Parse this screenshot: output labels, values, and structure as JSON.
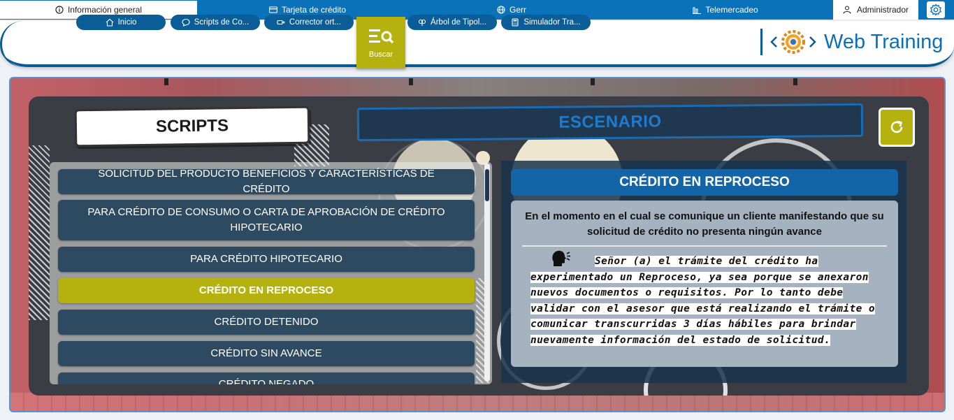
{
  "topbar": {
    "tabs": [
      {
        "label": "Información general",
        "icon": "info-icon",
        "active": true
      },
      {
        "label": "Tarjeta de crédito",
        "icon": "credit-card-icon",
        "active": false
      },
      {
        "label": "Gerr",
        "icon": "globe-icon",
        "active": false
      },
      {
        "label": "Telemercadeo",
        "icon": "chart-icon",
        "active": false
      }
    ],
    "user": "Administrador"
  },
  "nav": {
    "items": [
      {
        "label": "Inicio",
        "icon": "home-icon"
      },
      {
        "label": "Scripts de Co...",
        "icon": "chat-icon"
      },
      {
        "label": "Corrector ort...",
        "icon": "spellcheck-icon"
      },
      {
        "label": "Árbol de Tipol...",
        "icon": "tree-icon"
      },
      {
        "label": "Simulador Tra...",
        "icon": "calculator-icon"
      }
    ],
    "search_label": "Buscar",
    "brand": "Web Training"
  },
  "scripts": {
    "title": "SCRIPTS",
    "items": [
      "SOLICITUD DEL PRODUCTO BENEFICIOS Y CARACTERÍSTICAS DE CRÉDITO",
      "PARA CRÉDITO DE CONSUMO O CARTA DE APROBACIÓN DE CRÉDITO HIPOTECARIO",
      "PARA CRÉDITO HIPOTECARIO",
      "CRÉDITO EN REPROCESO",
      "CRÉDITO DETENIDO",
      "CRÉDITO SIN AVANCE",
      "CRÉDITO NEGADO"
    ],
    "active_index": 3
  },
  "escenario": {
    "title": "ESCENARIO",
    "header": "CRÉDITO EN REPROCESO",
    "description": "En el momento en el cual se comunique un cliente manifestando que su solicitud de crédito no presenta ningún avance",
    "script": "Señor (a) el trámite del crédito ha experimentado un Reproceso, ya sea porque se anexaron nuevos documentos o requisitos. Por lo tanto debe validar con el asesor que está realizando el trámite o comunicar transcurridas 3 días hábiles para brindar nuevamente información del estado de solicitud."
  },
  "colors": {
    "primary": "#0a72b8",
    "accent": "#b5b20f",
    "dark_panel": "#2e4a60"
  }
}
